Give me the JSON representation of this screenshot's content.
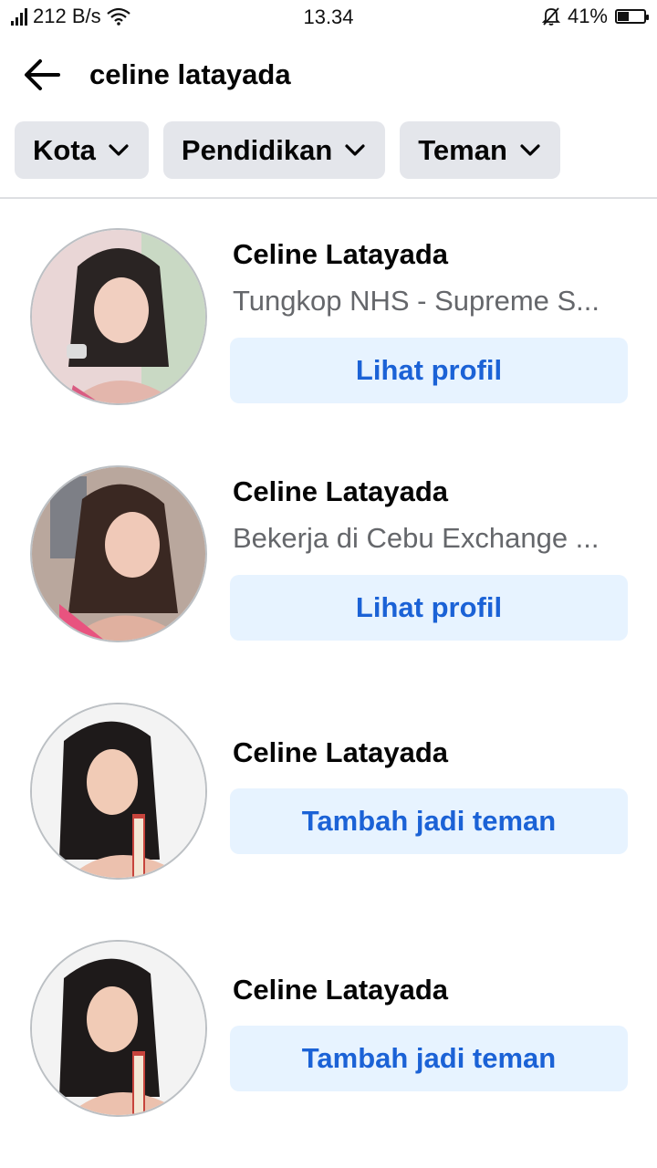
{
  "status_bar": {
    "network_speed": "212 B/s",
    "time": "13.34",
    "battery_percent": "41%",
    "battery_level": 0.41
  },
  "header": {
    "search_query": "celine latayada"
  },
  "filters": [
    {
      "label": "Kota"
    },
    {
      "label": "Pendidikan"
    },
    {
      "label": "Teman"
    }
  ],
  "results": [
    {
      "name": "Celine Latayada",
      "subtitle": "Tungkop NHS - Supreme S...",
      "action": "Lihat profil"
    },
    {
      "name": "Celine Latayada",
      "subtitle": "Bekerja di Cebu Exchange ...",
      "action": "Lihat profil"
    },
    {
      "name": "Celine Latayada",
      "action": "Tambah jadi teman"
    },
    {
      "name": "Celine Latayada",
      "action": "Tambah jadi teman"
    }
  ],
  "colors": {
    "accent_text": "#1b62d6",
    "button_bg": "#e7f3ff",
    "chip_bg": "#e4e6eb",
    "subtitle_text": "#65676b"
  }
}
